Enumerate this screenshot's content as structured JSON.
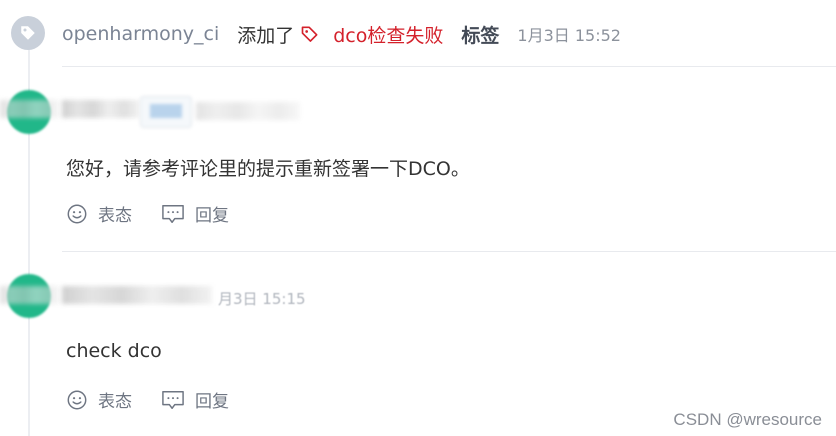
{
  "event": {
    "actor": "openharmony_ci",
    "action": "添加了",
    "label_name": "dco检查失败",
    "label_word": "标签",
    "time": "1月3日 15:52"
  },
  "comments": [
    {
      "body": "您好，请参考评论里的提示重新签署一下DCO。",
      "react_label": "表态",
      "reply_label": "回复"
    },
    {
      "body": "check dco",
      "react_label": "表态",
      "reply_label": "回复",
      "time_fragment": "月3日 15:15"
    }
  ],
  "colors": {
    "label_red": "#d4212b",
    "avatar_green": "#21b789",
    "muted_gray": "#7b8494"
  },
  "icons": {
    "event": "tag-icon",
    "react": "smiley-icon",
    "reply": "comment-icon"
  },
  "watermark": "CSDN @wresource"
}
